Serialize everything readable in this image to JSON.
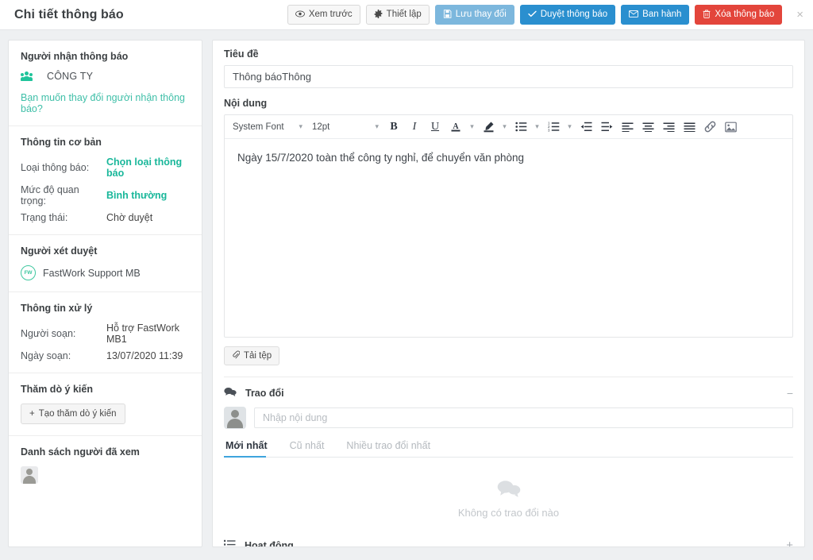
{
  "header": {
    "title": "Chi tiết thông báo",
    "actions": [
      {
        "label": "Xem trước",
        "icon": "eye-icon",
        "glyph": "◉",
        "style": "default"
      },
      {
        "label": "Thiết lập",
        "icon": "gear-icon",
        "glyph": "⚙",
        "style": "default"
      },
      {
        "label": "Lưu thay đổi",
        "icon": "save-icon",
        "glyph": "Ὃe",
        "style": "light-blue"
      },
      {
        "label": "Duyệt thông báo",
        "icon": "check-icon",
        "glyph": "✔",
        "style": "blue"
      },
      {
        "label": "Ban hành",
        "icon": "envelope-icon",
        "glyph": "✉",
        "style": "blue"
      },
      {
        "label": "Xóa thông báo",
        "icon": "trash-icon",
        "glyph": "Ὕ1",
        "style": "red"
      }
    ],
    "close_label": "×"
  },
  "sidebar": {
    "recipients": {
      "title": "Người nhận thông báo",
      "group_name": "CÔNG TY",
      "change_link": "Bạn muốn thay đổi người nhận thông báo?"
    },
    "basic_info": {
      "title": "Thông tin cơ bản",
      "rows": [
        {
          "label": "Loại thông báo:",
          "value": "Chọn loại thông báo",
          "accent": true
        },
        {
          "label": "Mức độ quan trọng:",
          "value": "Bình thường",
          "accent": true
        },
        {
          "label": "Trạng thái:",
          "value": "Chờ duyệt",
          "accent": false
        }
      ]
    },
    "approver": {
      "title": "Người xét duyệt",
      "avatar_initials": "FW",
      "name": "FastWork Support MB"
    },
    "processing": {
      "title": "Thông tin xử lý",
      "rows": [
        {
          "label": "Người soạn:",
          "value": "Hỗ trợ FastWork MB1"
        },
        {
          "label": "Ngày soạn:",
          "value": "13/07/2020 11:39"
        }
      ]
    },
    "poll": {
      "title": "Thăm dò ý kiến",
      "create_label": "Tạo thăm dò ý kiến",
      "plus": "+"
    },
    "viewers": {
      "title": "Danh sách người đã xem"
    }
  },
  "main": {
    "title_field": {
      "label": "Tiêu đề",
      "value": "Thông báoThông",
      "placeholder": "Tiêu đề"
    },
    "content_field": {
      "label": "Nội dung",
      "body_text": "Ngày 15/7/2020 toàn thể công ty nghỉ, để chuyển văn phòng"
    },
    "toolbar": {
      "font_value": "System Font",
      "size_value": "12pt",
      "buttons": [
        {
          "name": "bold-icon",
          "label": "B"
        },
        {
          "name": "italic-icon",
          "label": "I"
        },
        {
          "name": "underline-icon",
          "label": "U"
        },
        {
          "name": "font-color-icon",
          "label": "A"
        },
        {
          "name": "highlight-icon",
          "label": "✎"
        },
        {
          "name": "bullet-list-icon",
          "label": "☰"
        },
        {
          "name": "numbered-list-icon",
          "label": "☰"
        },
        {
          "name": "outdent-icon",
          "label": "⇤"
        },
        {
          "name": "indent-icon",
          "label": "⇥"
        },
        {
          "name": "align-left-icon",
          "label": "☰"
        },
        {
          "name": "align-center-icon",
          "label": "☰"
        },
        {
          "name": "align-right-icon",
          "label": "☰"
        },
        {
          "name": "align-justify-icon",
          "label": "☰"
        },
        {
          "name": "link-icon",
          "label": "ὑ7"
        },
        {
          "name": "image-icon",
          "label": "Ὓc"
        }
      ]
    },
    "attach": {
      "label": "Tải tệp",
      "icon": "paperclip-icon"
    },
    "discussion": {
      "title": "Trao đổi",
      "collapse_glyph": "−",
      "input_placeholder": "Nhập nội dung",
      "input_value": "",
      "tabs": [
        {
          "label": "Mới nhất",
          "active": true
        },
        {
          "label": "Cũ nhất",
          "active": false
        },
        {
          "label": "Nhiều trao đổi nhất",
          "active": false
        }
      ],
      "empty_text": "Không có trao đổi nào",
      "empty_icon": "Ὂc"
    },
    "activity": {
      "title": "Hoạt động",
      "expand_glyph": "+"
    }
  },
  "colors": {
    "accent_green": "#19b79a",
    "link_green": "#3fbfa8",
    "primary_blue": "#2a8fcf",
    "muted_blue": "#7cb7dd",
    "danger_red": "#e3453b",
    "tab_underline": "#3ea4dd"
  }
}
